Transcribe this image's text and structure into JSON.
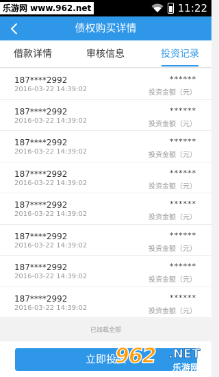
{
  "status_bar": {
    "watermark": "乐游网 www.962.net",
    "time": "11:22"
  },
  "nav": {
    "title": "债权购买详情"
  },
  "tabs": [
    {
      "label": "借款详情",
      "active": false
    },
    {
      "label": "审核信息",
      "active": false
    },
    {
      "label": "投资记录",
      "active": true
    }
  ],
  "records": [
    {
      "phone": "187****2992",
      "time": "2016-03-22 14:39:02",
      "amount": "******",
      "amount_label": "投资金额（元）"
    },
    {
      "phone": "187****2992",
      "time": "2016-03-22 14:39:02",
      "amount": "******",
      "amount_label": "投资金额（元）"
    },
    {
      "phone": "187****2992",
      "time": "2016-03-22 14:39:02",
      "amount": "******",
      "amount_label": "投资金额（元）"
    },
    {
      "phone": "187****2992",
      "time": "2016-03-22 14:39:02",
      "amount": "******",
      "amount_label": "投资金额（元）"
    },
    {
      "phone": "187****2992",
      "time": "2016-03-22 14:39:02",
      "amount": "******",
      "amount_label": "投资金额（元）"
    },
    {
      "phone": "187****2992",
      "time": "2016-03-22 14:39:02",
      "amount": "******",
      "amount_label": "投资金额（元）"
    },
    {
      "phone": "187****2992",
      "time": "2016-03-22 14:39:02",
      "amount": "******",
      "amount_label": "投资金额（元）"
    },
    {
      "phone": "187****2992",
      "time": "2016-03-22 14:39:02",
      "amount": "******",
      "amount_label": "投资金额（元）"
    }
  ],
  "list_footer": "已加载全部",
  "footer": {
    "button_label": "立即投资"
  },
  "watermark_logo": {
    "number": "962",
    "domain": ".NET",
    "brand": "乐游网"
  },
  "colors": {
    "primary": "#2f97e8",
    "watermark_orange": "#ff9a00"
  }
}
